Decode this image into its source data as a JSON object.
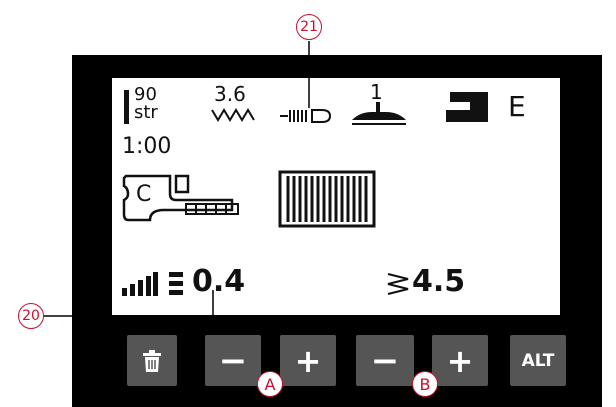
{
  "callouts": {
    "c21": "21",
    "c20": "20",
    "a": "A",
    "b": "B"
  },
  "display": {
    "needle_top": "90",
    "needle_bottom": "str",
    "stitch_width": "3.6",
    "presser_foot_number": "1",
    "foot_letter": "E",
    "time": "1:00",
    "foot_code": "C",
    "stitch_length_value": "0.4",
    "stitch_width_value": "4.5"
  },
  "buttons": {
    "minus_a": "−",
    "plus_a": "+",
    "minus_b": "−",
    "plus_b": "+",
    "alt": "ALT"
  },
  "colors": {
    "callout": "#c8102e",
    "panel": "#000000",
    "button": "#555555"
  }
}
